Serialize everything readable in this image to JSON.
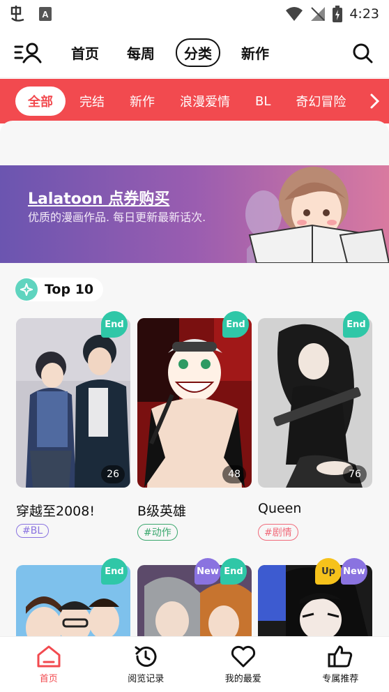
{
  "status_bar": {
    "time": "4:23",
    "icons": [
      "app-notification-icon",
      "a-icon",
      "wifi-icon",
      "no-signal-icon",
      "battery-charging-icon"
    ]
  },
  "top_nav": {
    "menu_icon": "user-menu-icon",
    "tabs": [
      {
        "label": "首页",
        "active": false
      },
      {
        "label": "每周",
        "active": false
      },
      {
        "label": "分类",
        "active": true
      },
      {
        "label": "新作",
        "active": false
      }
    ],
    "search_icon": "search-icon"
  },
  "category_bar": {
    "items": [
      "全部",
      "完结",
      "新作",
      "浪漫爱情",
      "BL",
      "奇幻冒险"
    ],
    "active_index": 0,
    "arrow_icon": "chevron-right-icon",
    "color": "#f24a4f"
  },
  "banner": {
    "title": "Lalatoon 点券购买",
    "subtitle": "优质的漫画作品. 每日更新最新话次."
  },
  "top10": {
    "label": "Top 10",
    "icon": "sparkle-icon"
  },
  "cards": [
    {
      "title": "穿越至2008!",
      "tag": "#BL",
      "tag_color": "#8a73e0",
      "episodes": "26",
      "badges": [
        "End"
      ]
    },
    {
      "title": "B级英雄",
      "tag": "#动作",
      "tag_color": "#3aa76d",
      "episodes": "48",
      "badges": [
        "End"
      ]
    },
    {
      "title": "Queen",
      "tag": "#剧情",
      "tag_color": "#f06a7a",
      "episodes": "76",
      "badges": [
        "End"
      ]
    }
  ],
  "cards_row2": [
    {
      "badges": [
        "End"
      ]
    },
    {
      "badges": [
        "New",
        "End"
      ]
    },
    {
      "badges": [
        "Up",
        "New"
      ]
    }
  ],
  "bottom_nav": {
    "items": [
      {
        "label": "首页",
        "icon": "home-icon",
        "active": true
      },
      {
        "label": "阅览记录",
        "icon": "history-icon",
        "active": false
      },
      {
        "label": "我的最爱",
        "icon": "heart-icon",
        "active": false
      },
      {
        "label": "专属推荐",
        "icon": "thumbs-up-icon",
        "active": false
      }
    ]
  }
}
